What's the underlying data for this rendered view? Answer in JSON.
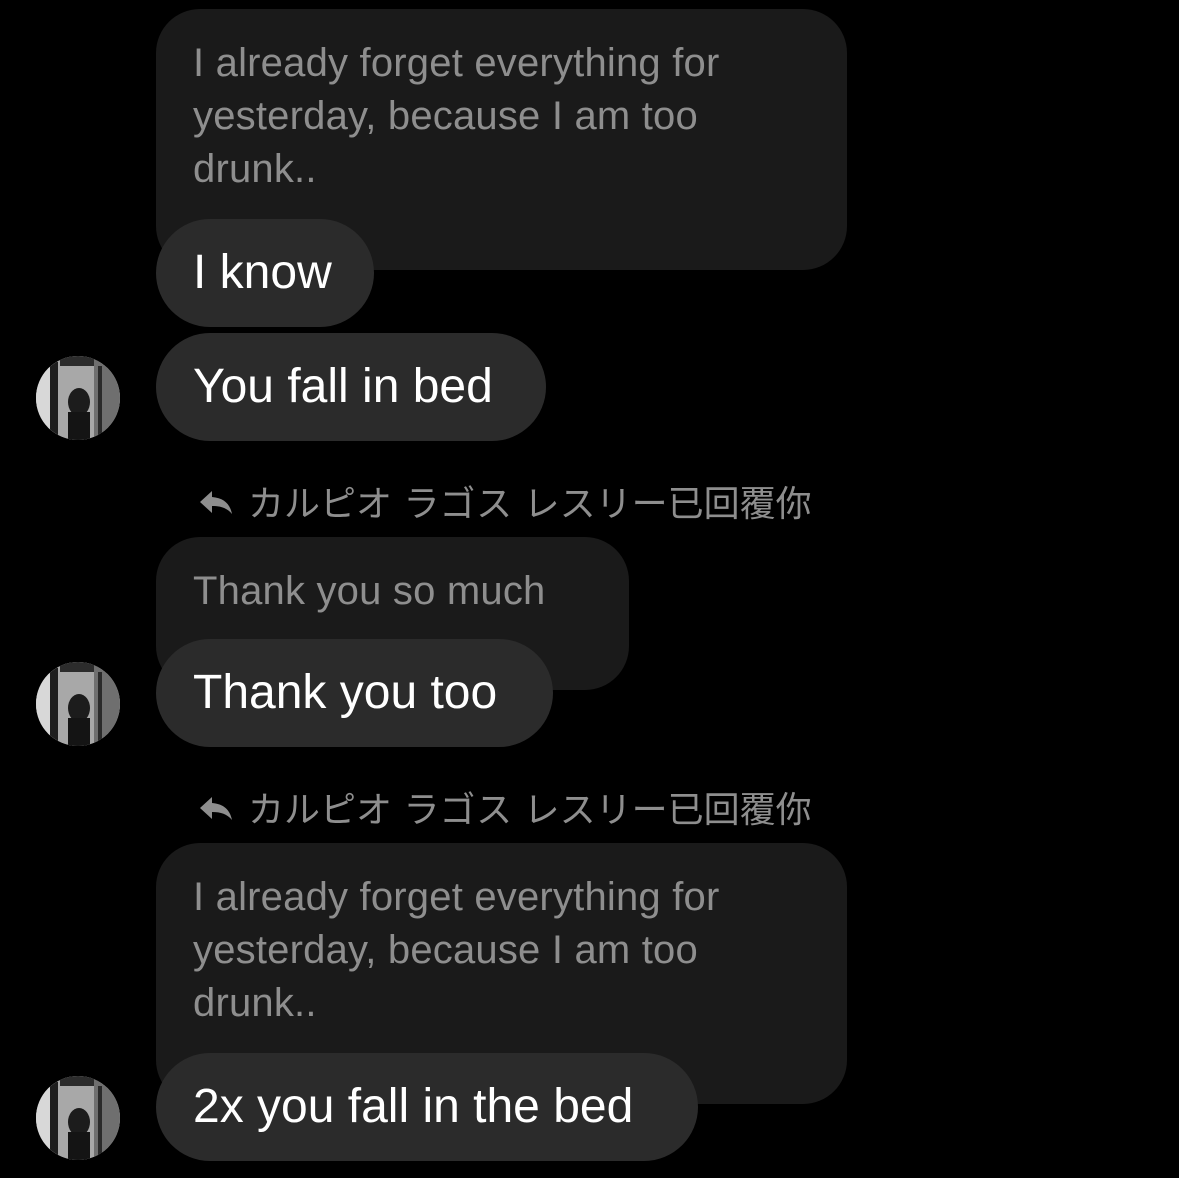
{
  "thread": {
    "block1": {
      "quoted_text": "I already forget everything for yesterday, because I am too drunk..",
      "reply_1": "I know",
      "reply_2": "You fall in bed"
    },
    "block2": {
      "reply_label": "カルピオ ラゴス レスリー已回覆你",
      "quoted_text": "Thank you so much",
      "reply": "Thank you too"
    },
    "block3": {
      "reply_label": "カルピオ ラゴス レスリー已回覆你",
      "quoted_text": "I already forget everything for yesterday, because I am too drunk..",
      "reply": "2x you fall in the bed"
    }
  },
  "icons": {
    "reply": "reply-arrow-icon",
    "avatar": "user-avatar"
  },
  "colors": {
    "background": "#000000",
    "quoted_bubble": "#1a1a1a",
    "message_bubble": "#2b2b2b",
    "quoted_text": "#8e8e8e",
    "message_text": "#ffffff"
  }
}
